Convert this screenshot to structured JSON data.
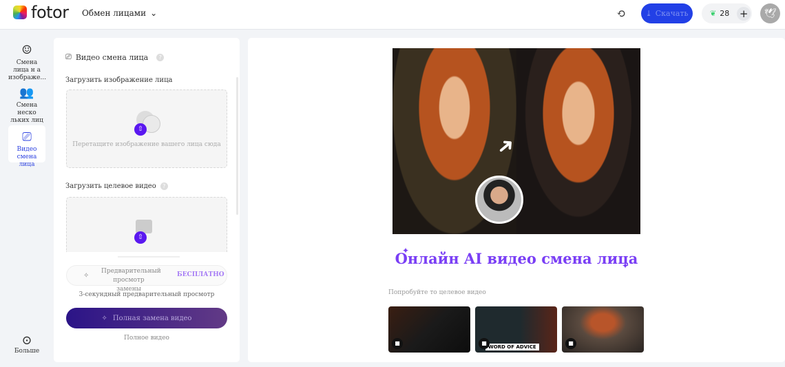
{
  "header": {
    "logo": "fotor",
    "menu": "Обмен лицами",
    "download": "Скачать",
    "credits": "28"
  },
  "sidebar": {
    "items": [
      {
        "label": "Смена лица н а изображе..."
      },
      {
        "label": "Смена неско льких лиц"
      },
      {
        "label": "Видео смена лица"
      }
    ],
    "more": "Больше"
  },
  "panel": {
    "title": "Видео смена лица",
    "face_label": "Загрузить изображение лица",
    "face_drop": "Перетащите изображение вашего лица сюда",
    "video_label": "Загрузить целевое видео",
    "preview_label": "Предварительный просмотр замены",
    "free": "БЕСПЛАТНО",
    "preview_sub": "3-секундный предварительный просмотр",
    "full_label": "Полная замена видео",
    "full_sub": "Полное видео"
  },
  "main": {
    "title": "Онлайн AI видео смена лица",
    "try_label": "Попробуйте то целевое видео",
    "thumb_caption": "WORD OF ADVICE"
  },
  "colors": {
    "accent": "#2240e6",
    "purple": "#7a3ff5"
  }
}
